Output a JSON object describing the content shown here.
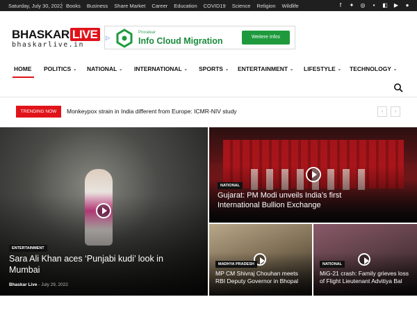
{
  "topbar": {
    "date": "Saturday, July 30, 2022",
    "links": [
      "Books",
      "Business",
      "Share Market",
      "Career",
      "Education",
      "COVID19",
      "Science",
      "Religion",
      "Wildlife"
    ],
    "social_icons": [
      "facebook-icon",
      "twitter-icon",
      "instagram-icon",
      "linkedin-icon",
      "flipboard-icon",
      "youtube-icon",
      "pinterest-icon"
    ]
  },
  "logo": {
    "main": "BHASKAR",
    "badge": "LIVE",
    "sub": "bhaskarlive.in"
  },
  "ad": {
    "small": "Proratear",
    "headline": "Info Cloud Migration",
    "cta": "Weitere Infos"
  },
  "nav": {
    "items": [
      {
        "label": "HOME"
      },
      {
        "label": "POLITICS"
      },
      {
        "label": "NATIONAL"
      },
      {
        "label": "INTERNATIONAL"
      },
      {
        "label": "SPORTS"
      },
      {
        "label": "ENTERTAINMENT"
      },
      {
        "label": "LIFESTYLE"
      },
      {
        "label": "TECHNOLOGY"
      }
    ]
  },
  "trending": {
    "badge": "TRENDING NOW",
    "headline": "Monkeypox strain in India different from Europe: ICMR-NIV study"
  },
  "stories": [
    {
      "category": "ENTERTAINMENT",
      "title": "Sara Ali Khan aces ‘Punjabi kudi’ look in Mumbai",
      "author": "Bhaskar Live",
      "date": "July 29, 2022"
    },
    {
      "category": "NATIONAL",
      "title": "Gujarat: PM Modi unveils India’s first International Bullion Exchange"
    },
    {
      "category": "MADHYA PRADESH",
      "title": "MP CM Shivraj Chouhan meets RBI Deputy Governor in Bhopal"
    },
    {
      "category": "NATIONAL",
      "title": "MiG-21 crash: Family grieves loss of Flight Lieutenant Advitiya Bal"
    }
  ],
  "colors": {
    "accent": "#e0131a",
    "ad_green": "#1e9a3d"
  }
}
